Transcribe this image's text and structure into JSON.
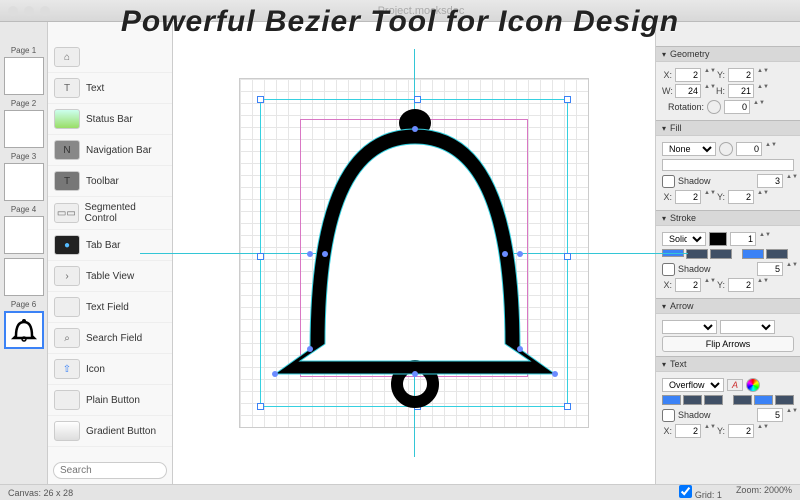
{
  "banner_text": "Powerful Bezier Tool for Icon Design",
  "document_title": "Project.mocksdoc",
  "pages": [
    {
      "label": "Page 1"
    },
    {
      "label": "Page 2"
    },
    {
      "label": "Page 3"
    },
    {
      "label": "Page 4"
    },
    {
      "label": ""
    },
    {
      "label": "Page 6"
    }
  ],
  "selected_page": "Page 6",
  "components": [
    {
      "label": "Text",
      "glyph": "T"
    },
    {
      "label": "Status Bar",
      "glyph": "—"
    },
    {
      "label": "Navigation Bar",
      "glyph": "N"
    },
    {
      "label": "Toolbar",
      "glyph": "T"
    },
    {
      "label": "Segmented Control",
      "glyph": "⊟"
    },
    {
      "label": "Tab Bar",
      "glyph": "▪"
    },
    {
      "label": "Table View",
      "glyph": "›"
    },
    {
      "label": "Text Field",
      "glyph": " "
    },
    {
      "label": "Search Field",
      "glyph": "⌕"
    },
    {
      "label": "Icon",
      "glyph": "⇧"
    },
    {
      "label": "Plain Button",
      "glyph": " "
    },
    {
      "label": "Gradient Button",
      "glyph": " "
    }
  ],
  "search_placeholder": "Search",
  "inspector": {
    "geometry": {
      "title": "Geometry",
      "x": "2",
      "y": "2",
      "w": "24",
      "h": "21",
      "rotation_label": "Rotation:",
      "rotation": "0"
    },
    "fill": {
      "title": "Fill",
      "mode": "None",
      "opacity": "0",
      "shadow_label": "Shadow",
      "shadow": "3",
      "sx": "2",
      "sy": "2"
    },
    "stroke": {
      "title": "Stroke",
      "mode": "Solid",
      "width": "1",
      "shadow_label": "Shadow",
      "shadow": "5",
      "sx": "2",
      "sy": "2"
    },
    "arrow": {
      "title": "Arrow",
      "flip_label": "Flip Arrows"
    },
    "text": {
      "title": "Text",
      "mode": "Overflow",
      "shadow_label": "Shadow",
      "shadow": "5",
      "sx": "2",
      "sy": "2"
    }
  },
  "status": {
    "canvas_label": "Canvas:",
    "canvas_size": "26 x 28",
    "grid_label": "Grid:",
    "grid_value": "1",
    "zoom_label": "Zoom:",
    "zoom_value": "2000%"
  }
}
